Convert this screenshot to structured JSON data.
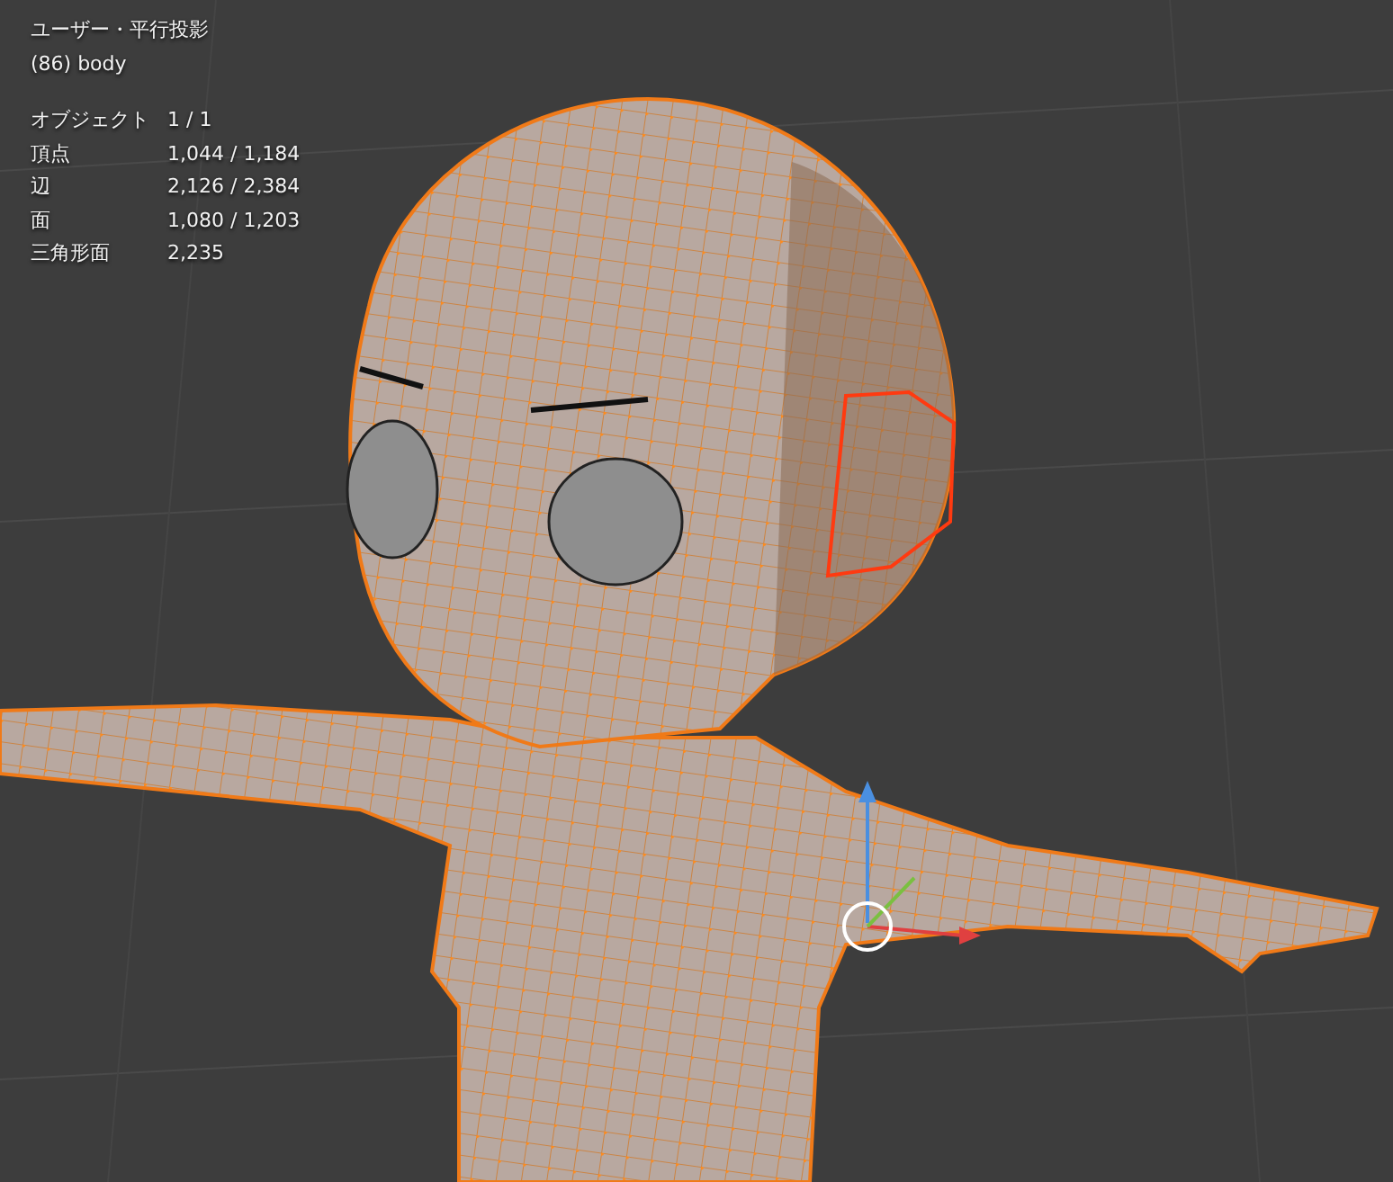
{
  "viewport": {
    "view_name": "ユーザー・平行投影",
    "object_name": "(86) body",
    "stats": [
      {
        "label": "オブジェクト",
        "value": "1 / 1"
      },
      {
        "label": "頂点",
        "value": "1,044 / 1,184"
      },
      {
        "label": "辺",
        "value": "2,126 / 2,384"
      },
      {
        "label": "面",
        "value": "1,080 / 1,203"
      },
      {
        "label": "三角形面",
        "value": "2,235"
      }
    ]
  }
}
